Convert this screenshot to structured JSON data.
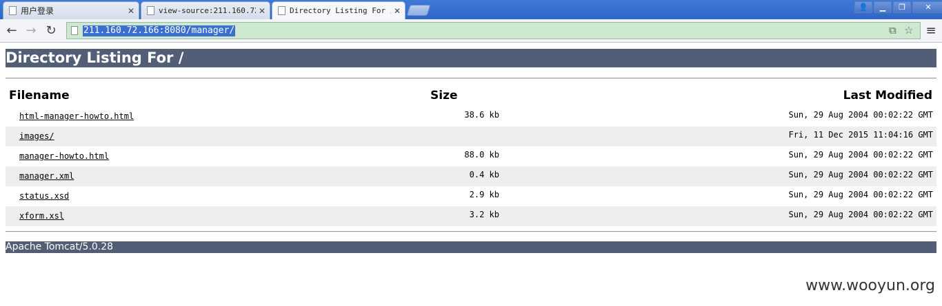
{
  "browser": {
    "tabs": [
      {
        "title": "用户登录"
      },
      {
        "title": "view-source:211.160.72."
      },
      {
        "title": "Directory Listing For /"
      }
    ],
    "url": "211.160.72.166:8080/manager/"
  },
  "page": {
    "heading": "Directory Listing For /",
    "columns": {
      "filename": "Filename",
      "size": "Size",
      "modified": "Last Modified"
    },
    "rows": [
      {
        "name": "html-manager-howto.html",
        "size": "38.6 kb",
        "modified": "Sun, 29 Aug 2004 00:02:22 GMT"
      },
      {
        "name": "images/",
        "size": "",
        "modified": "Fri, 11 Dec 2015 11:04:16 GMT"
      },
      {
        "name": "manager-howto.html",
        "size": "88.0 kb",
        "modified": "Sun, 29 Aug 2004 00:02:22 GMT"
      },
      {
        "name": "manager.xml",
        "size": "0.4 kb",
        "modified": "Sun, 29 Aug 2004 00:02:22 GMT"
      },
      {
        "name": "status.xsd",
        "size": "2.9 kb",
        "modified": "Sun, 29 Aug 2004 00:02:22 GMT"
      },
      {
        "name": "xform.xsl",
        "size": "3.2 kb",
        "modified": "Sun, 29 Aug 2004 00:02:22 GMT"
      }
    ],
    "footer": "Apache Tomcat/5.0.28"
  },
  "watermark": "www.wooyun.org",
  "colors": {
    "header_bar": "#525d76",
    "alt_row": "#eeeeee",
    "omnibox_bg": "#cce8cf",
    "url_highlight": "#3a6fd0"
  },
  "icons": {
    "tab": "page-icon",
    "back": "back-arrow-icon",
    "forward": "forward-arrow-icon",
    "reload": "reload-icon",
    "star": "star-icon",
    "menu": "menu-icon"
  }
}
